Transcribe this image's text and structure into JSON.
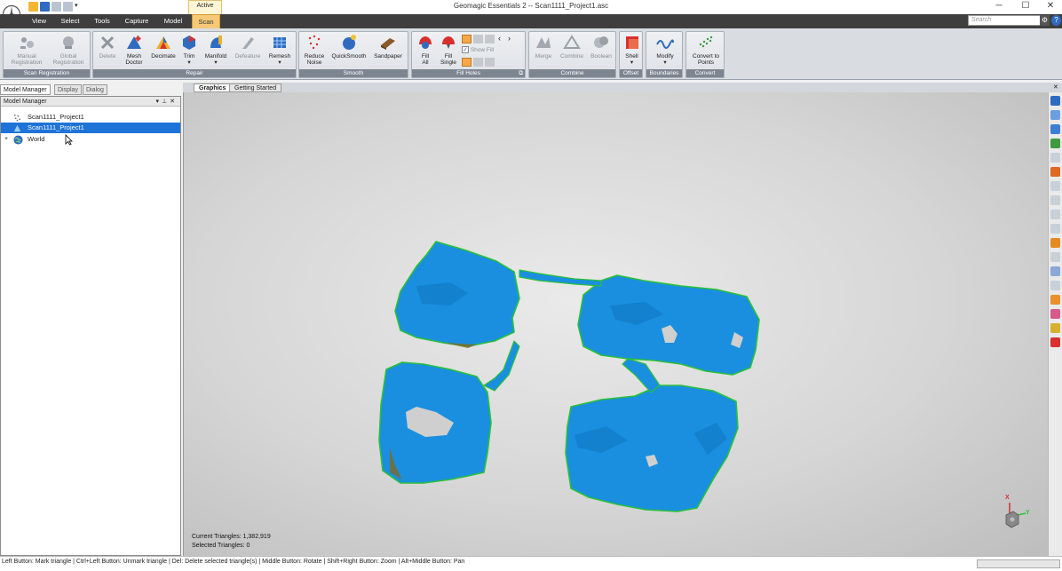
{
  "window": {
    "title": "Geomagic Essentials 2 -- Scan1111_Project1.asc",
    "context_tab_label": "Active",
    "minimize_glyph": "─",
    "maximize_glyph": "☐",
    "close_glyph": "✕"
  },
  "tabs": [
    {
      "label": "View"
    },
    {
      "label": "Select"
    },
    {
      "label": "Tools"
    },
    {
      "label": "Capture"
    },
    {
      "label": "Model"
    },
    {
      "label": "Scan",
      "active": true
    }
  ],
  "search": {
    "placeholder": "Search"
  },
  "ribbon": {
    "groups": [
      {
        "label": "Scan Registration",
        "buttons": [
          {
            "label": "Manual\nRegistration",
            "icon": "manual-registration-icon",
            "disabled": true
          },
          {
            "label": "Global\nRegistration",
            "icon": "global-registration-icon",
            "disabled": true
          }
        ]
      },
      {
        "label": "Repair",
        "buttons": [
          {
            "label": "Delete",
            "icon": "delete-icon",
            "disabled": true
          },
          {
            "label": "Mesh\nDoctor",
            "icon": "mesh-doctor-icon"
          },
          {
            "label": "Decimate",
            "icon": "decimate-icon"
          },
          {
            "label": "Trim",
            "icon": "trim-icon"
          },
          {
            "label": "Manifold",
            "icon": "manifold-icon"
          },
          {
            "label": "Defeature",
            "icon": "defeature-icon",
            "disabled": true
          },
          {
            "label": "Remesh",
            "icon": "remesh-icon"
          }
        ]
      },
      {
        "label": "Smooth",
        "buttons": [
          {
            "label": "Reduce\nNoise",
            "icon": "reduce-noise-icon"
          },
          {
            "label": "QuickSmooth",
            "icon": "quicksmooth-icon"
          },
          {
            "label": "Sandpaper",
            "icon": "sandpaper-icon"
          }
        ]
      },
      {
        "label": "Fill Holes",
        "buttons": [
          {
            "label": "Fill\nAll",
            "icon": "fill-all-icon"
          },
          {
            "label": "Fill\nSingle",
            "icon": "fill-single-icon"
          }
        ],
        "show_fill_label": "Show Fill"
      },
      {
        "label": "Combine",
        "buttons": [
          {
            "label": "Merge",
            "icon": "merge-icon",
            "disabled": true
          },
          {
            "label": "Combine",
            "icon": "combine-icon",
            "disabled": true
          },
          {
            "label": "Boolean",
            "icon": "boolean-icon",
            "disabled": true
          }
        ]
      },
      {
        "label": "Offset",
        "buttons": [
          {
            "label": "Shell",
            "icon": "shell-icon"
          }
        ]
      },
      {
        "label": "Boundaries",
        "buttons": [
          {
            "label": "Modify",
            "icon": "modify-icon"
          }
        ]
      },
      {
        "label": "Convert",
        "buttons": [
          {
            "label": "Convert to\nPoints",
            "icon": "convert-to-points-icon"
          }
        ]
      }
    ]
  },
  "panel_tabs": [
    {
      "label": "Model Manager",
      "active": true
    },
    {
      "label": "Display"
    },
    {
      "label": "Dialog"
    }
  ],
  "model_manager": {
    "title": "Model Manager",
    "items": [
      {
        "label": "Scan1111_Project1",
        "icon": "point-cloud-icon"
      },
      {
        "label": "Scan1111_Project1",
        "icon": "mesh-icon",
        "selected": true
      },
      {
        "label": "World",
        "icon": "globe-icon",
        "expander": "+"
      }
    ]
  },
  "doc_tabs": [
    {
      "label": "Graphics",
      "active": true
    },
    {
      "label": "Getting Started"
    }
  ],
  "viewport": {
    "current_triangles": "Current Triangles: 1,382,919",
    "selected_triangles": "Selected Triangles: 0",
    "axis_x": "X",
    "axis_y": "Y"
  },
  "statusbar": {
    "text": "Left Button: Mark triangle | Ctrl+Left Button: Unmark triangle | Del: Delete selected triangle(s) | Middle Button: Rotate | Shift+Right Button: Zoom | Alt+Middle Button: Pan"
  },
  "colors": {
    "mesh_blue": "#1a8fe0",
    "boundary_green": "#29c23a",
    "selection_blue": "#1e73d8",
    "active_tab": "#f5c978"
  }
}
